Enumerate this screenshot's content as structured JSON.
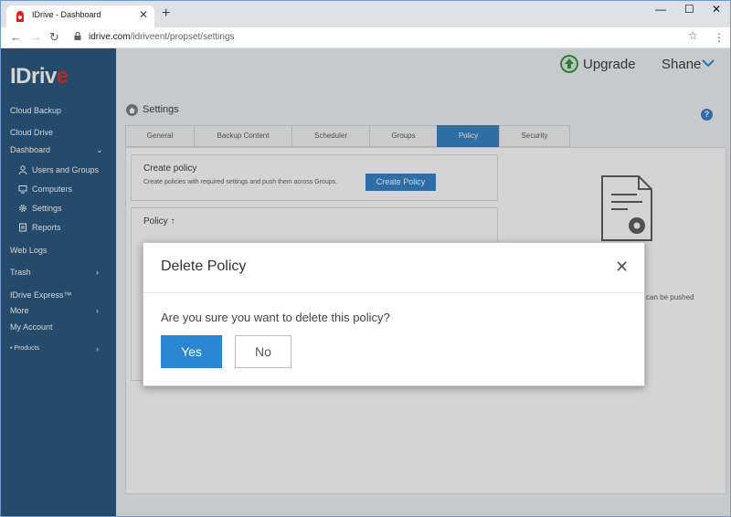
{
  "browser": {
    "tab_title": "IDrive - Dashboard",
    "tab_close": "✕",
    "new_tab": "+",
    "url_host": "idrive.com",
    "url_path": "/idriveent/propset/settings",
    "minimize": "—",
    "maximize": "☐",
    "close": "✕"
  },
  "sidebar": {
    "logo_text": "IDriv",
    "logo_e": "e",
    "items": [
      {
        "label": "Cloud Backup"
      },
      {
        "label": "Cloud Drive"
      },
      {
        "label": "Dashboard"
      },
      {
        "label": "Users and Groups"
      },
      {
        "label": "Computers"
      },
      {
        "label": "Settings"
      },
      {
        "label": "Reports"
      },
      {
        "label": "Web Logs"
      },
      {
        "label": "Trash"
      },
      {
        "label": "IDrive Express™"
      },
      {
        "label": "More"
      },
      {
        "label": "My Account"
      },
      {
        "label": "• Products"
      }
    ]
  },
  "header": {
    "upgrade": "Upgrade",
    "user": "Shane"
  },
  "breadcrumb": "Settings",
  "tabs": [
    {
      "label": "General"
    },
    {
      "label": "Backup Content"
    },
    {
      "label": "Scheduler"
    },
    {
      "label": "Groups"
    },
    {
      "label": "Policy",
      "active": true
    },
    {
      "label": "Security"
    }
  ],
  "create_policy": {
    "title": "Create policy",
    "description": "Create policies with required settings and push them across Groups.",
    "button": "Create Policy"
  },
  "policy_list": {
    "title": "Policy ↑"
  },
  "right_panel_text": "can be pushed",
  "modal": {
    "title": "Delete Policy",
    "message": "Are you sure you want to delete this policy?",
    "yes": "Yes",
    "no": "No"
  },
  "colors": {
    "sidebar": "#1e4f7a",
    "accent": "#2a7dc4",
    "logo_red": "#e1221b"
  }
}
